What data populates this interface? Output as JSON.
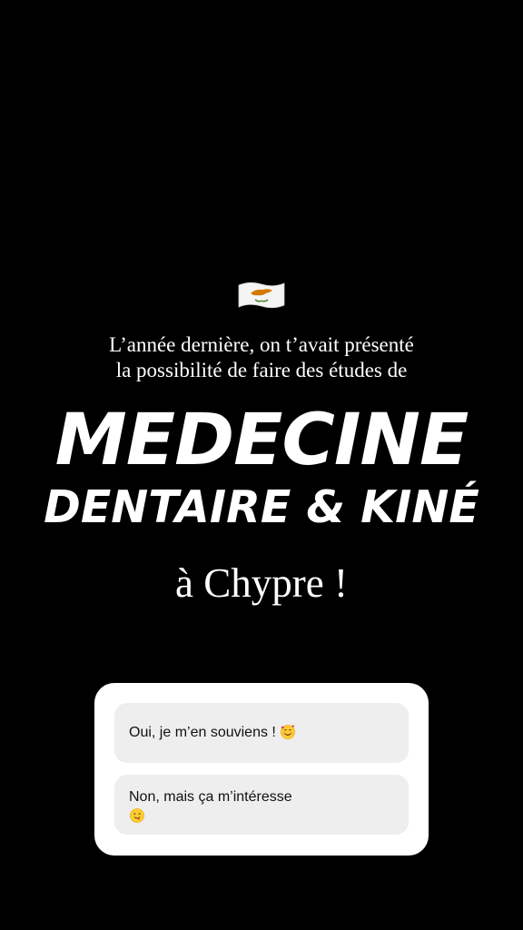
{
  "story": {
    "flag_icon": "cyprus-flag-icon",
    "intro_line1": "L’année dernière, on t’avait présenté",
    "intro_line2": "la possibilité de faire des études de",
    "headline_line1": "MEDECINE",
    "headline_line2": "DENTAIRE & KINÉ",
    "place": "à Chypre !"
  },
  "poll": {
    "options": [
      {
        "label": "Oui, je m’en souviens ! ",
        "emoji": "smiling-face-with-hearts-icon"
      },
      {
        "label": "Non, mais ça m’intéresse",
        "emoji": "face-savoring-food-icon"
      }
    ]
  },
  "colors": {
    "background": "#000000",
    "text": "#ffffff",
    "poll_card": "#ffffff",
    "poll_option": "#eeeeee"
  }
}
